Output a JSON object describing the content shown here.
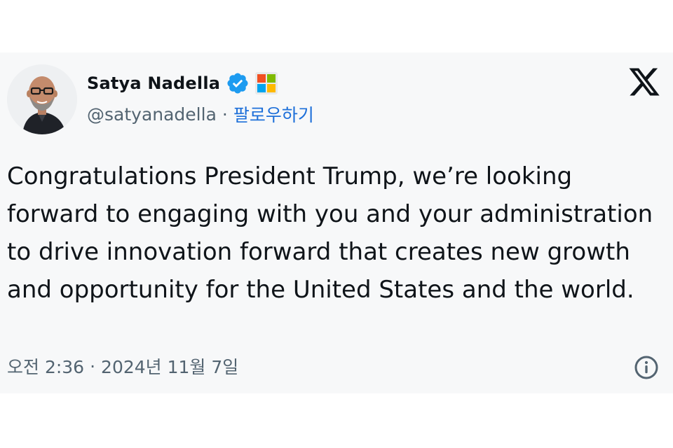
{
  "author": {
    "name": "Satya Nadella",
    "handle": "@satyanadella",
    "separator": "·",
    "follow_label": "팔로우하기",
    "verified_icon": "verified-badge-icon",
    "affiliate_icon": "microsoft-affiliate-icon",
    "avatar_icon": "profile-avatar"
  },
  "brand": {
    "logo_icon": "x-logo-icon"
  },
  "tweet": {
    "text": "Congratulations President Trump, we’re looking forward to engaging with you and your administration to drive innovation forward that creates new growth and opportunity for the United States and the world."
  },
  "meta": {
    "time": "오전 2:36",
    "separator": "·",
    "date": "2024년 11월 7일",
    "info_icon": "info-icon"
  },
  "colors": {
    "card_background": "#f7f8f9",
    "text_primary": "#0f1419",
    "text_secondary": "#536471",
    "link": "#1d6fd9",
    "verified": "#1d9bf0"
  }
}
